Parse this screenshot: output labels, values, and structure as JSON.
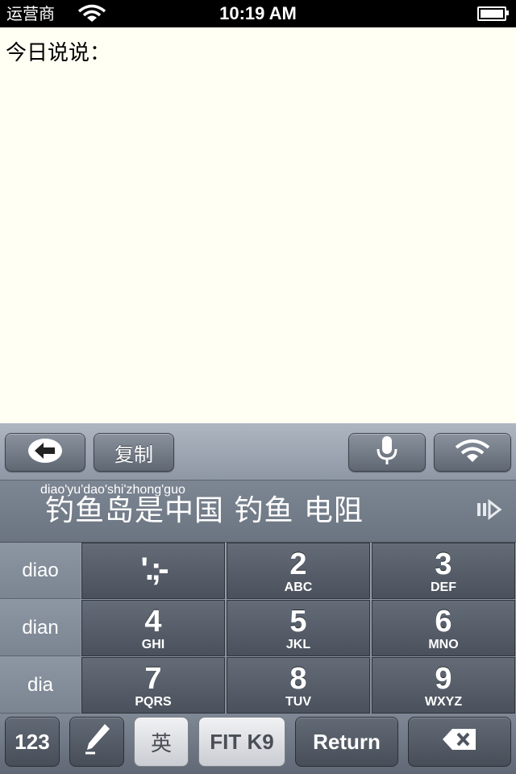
{
  "status_bar": {
    "carrier": "运营商",
    "time": "10:19 AM",
    "wifi_icon": "wifi-icon",
    "battery_icon": "battery-icon"
  },
  "composer": {
    "label": "今日说说："
  },
  "keyboard": {
    "toolbar": {
      "back_icon": "arrow-left-icon",
      "copy_label": "复制",
      "mic_icon": "microphone-icon",
      "wifi_icon": "wifi-icon"
    },
    "candidates": {
      "pinyin": "diao'yu'dao'shi'zhong'guo",
      "text": "钓鱼岛是中国 钓鱼 电阻",
      "more_icon": "more-candidates-icon"
    },
    "syllables": [
      "diao",
      "dian",
      "dia"
    ],
    "keys": [
      {
        "num": "'.;-",
        "letters": ""
      },
      {
        "num": "2",
        "letters": "ABC"
      },
      {
        "num": "3",
        "letters": "DEF"
      },
      {
        "num": "4",
        "letters": "GHI"
      },
      {
        "num": "5",
        "letters": "JKL"
      },
      {
        "num": "6",
        "letters": "MNO"
      },
      {
        "num": "7",
        "letters": "PQRS"
      },
      {
        "num": "8",
        "letters": "TUV"
      },
      {
        "num": "9",
        "letters": "WXYZ"
      }
    ],
    "bottom": {
      "numbers_label": "123",
      "pen_icon": "pen-icon",
      "english_label": "英",
      "fit_label": "FIT K9",
      "return_label": "Return",
      "delete_icon": "backspace-icon"
    }
  }
}
